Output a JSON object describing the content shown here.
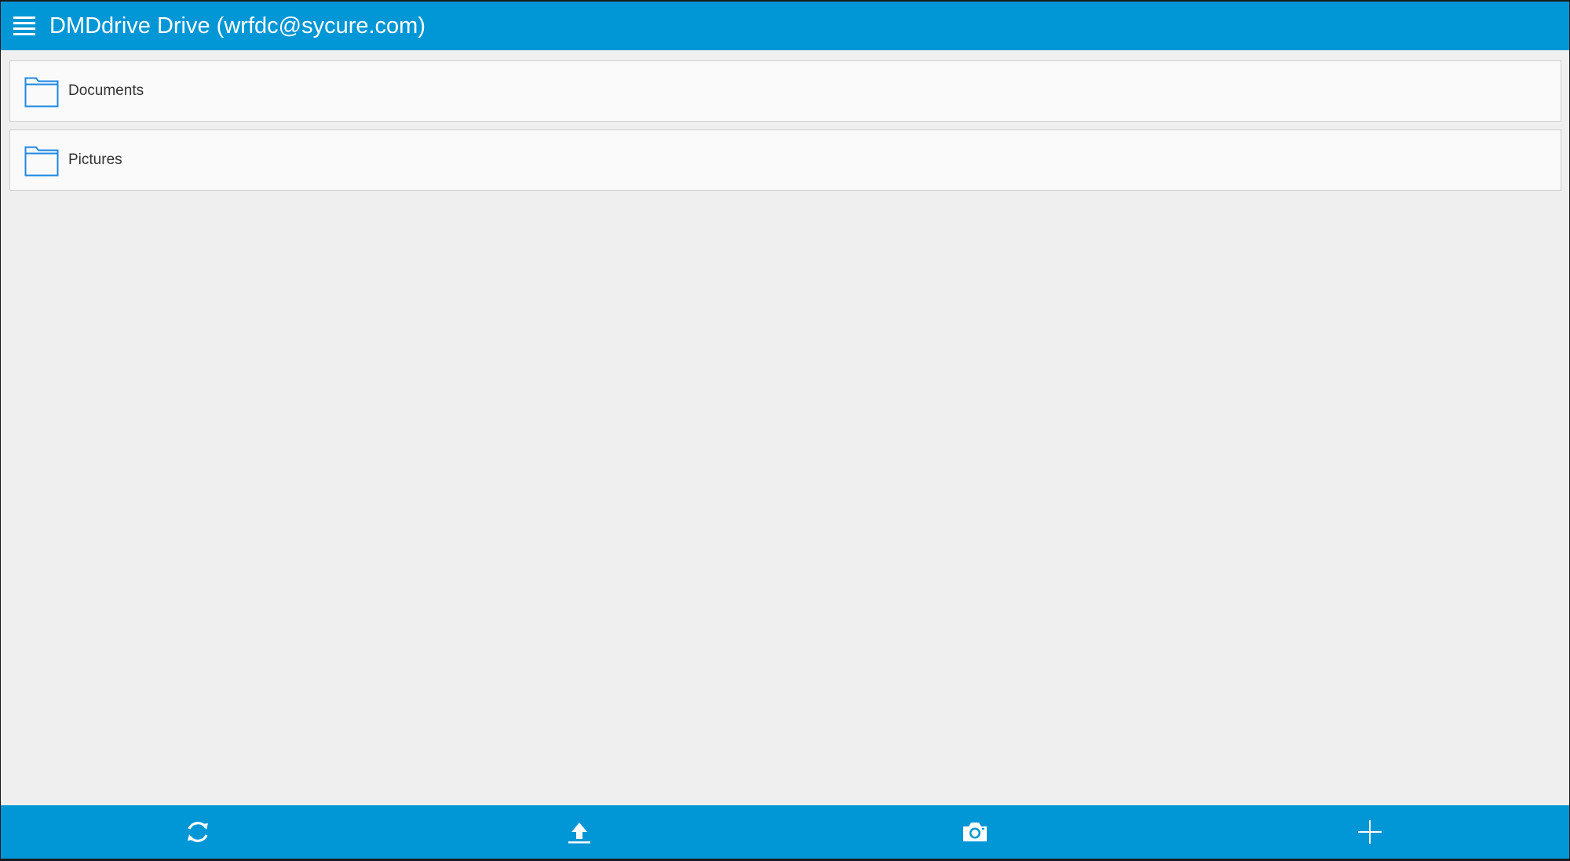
{
  "header": {
    "title": "DMDdrive Drive (wrfdc@sycure.com)",
    "menu_icon": "hamburger-menu-icon"
  },
  "folders": [
    {
      "name": "Documents",
      "icon": "folder-icon"
    },
    {
      "name": "Pictures",
      "icon": "folder-icon"
    }
  ],
  "toolbar": {
    "actions": [
      {
        "icon": "refresh-icon"
      },
      {
        "icon": "upload-icon"
      },
      {
        "icon": "camera-icon"
      },
      {
        "icon": "add-icon"
      }
    ]
  },
  "colors": {
    "accent": "#0196d5",
    "background": "#efefef",
    "row_background": "#fafafa",
    "folder_icon": "#1e88e5"
  }
}
